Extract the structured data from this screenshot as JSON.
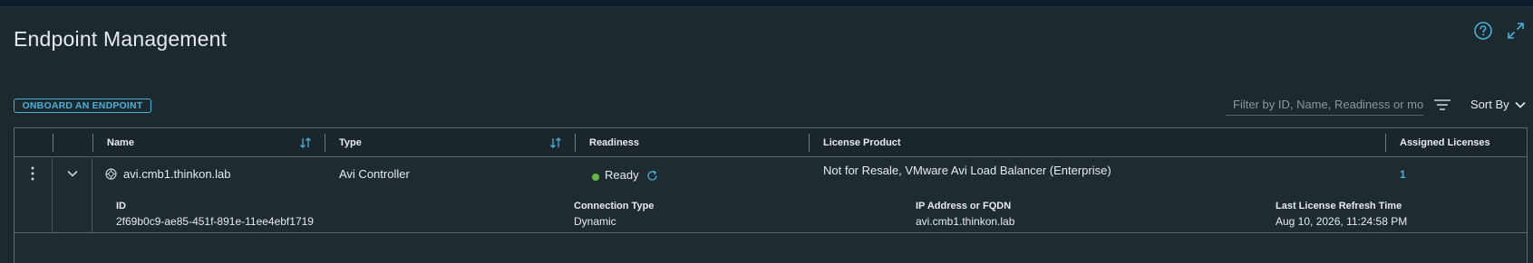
{
  "page": {
    "title": "Endpoint Management",
    "help_icon": "help-circle-icon",
    "expand_icon": "expand-arrows-icon"
  },
  "toolbar": {
    "onboard_label": "ONBOARD AN ENDPOINT",
    "filter_placeholder": "Filter by ID, Name, Readiness or more",
    "sort_label": "Sort By"
  },
  "grid": {
    "columns": {
      "name": "Name",
      "type": "Type",
      "readiness": "Readiness",
      "license_product": "License Product",
      "assigned_licenses": "Assigned Licenses"
    },
    "rows": [
      {
        "name": "avi.cmb1.thinkon.lab",
        "type": "Avi Controller",
        "readiness": "Ready",
        "readiness_color": "#62b53f",
        "license_product": "Not for Resale, VMware Avi Load Balancer (Enterprise)",
        "assigned_licenses": "1",
        "details": {
          "id_label": "ID",
          "id_value": "2f69b0c9-ae85-451f-891e-11ee4ebf1719",
          "connection_type_label": "Connection Type",
          "connection_type_value": "Dynamic",
          "ip_label": "IP Address or FQDN",
          "ip_value": "avi.cmb1.thinkon.lab",
          "refresh_label": "Last License Refresh Time",
          "refresh_value": "Aug 10, 2026, 11:24:58 PM"
        }
      }
    ]
  },
  "colors": {
    "accent": "#49afd9",
    "background": "#1c2a30",
    "ready": "#62b53f"
  }
}
